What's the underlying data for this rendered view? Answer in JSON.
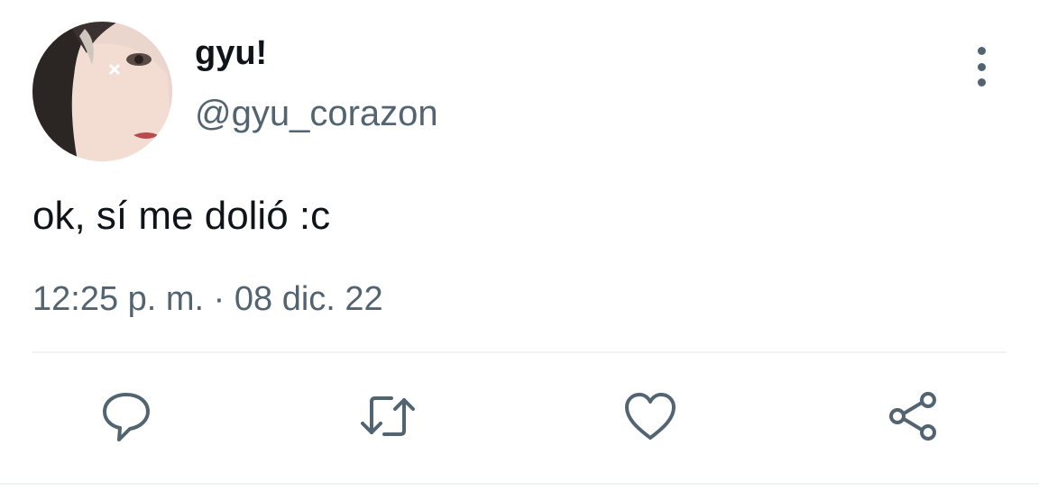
{
  "tweet": {
    "display_name": "gyu!",
    "handle": "@gyu_corazon",
    "text": "ok, sí me dolió :c",
    "timestamp": "12:25 p. m. · 08 dic. 22"
  },
  "actions": [
    "reply-icon",
    "retweet-icon",
    "like-icon",
    "share-icon"
  ],
  "colors": {
    "text_primary": "#0f1419",
    "text_secondary": "#536471",
    "icon": "#536471",
    "divider": "#eff3f4"
  }
}
